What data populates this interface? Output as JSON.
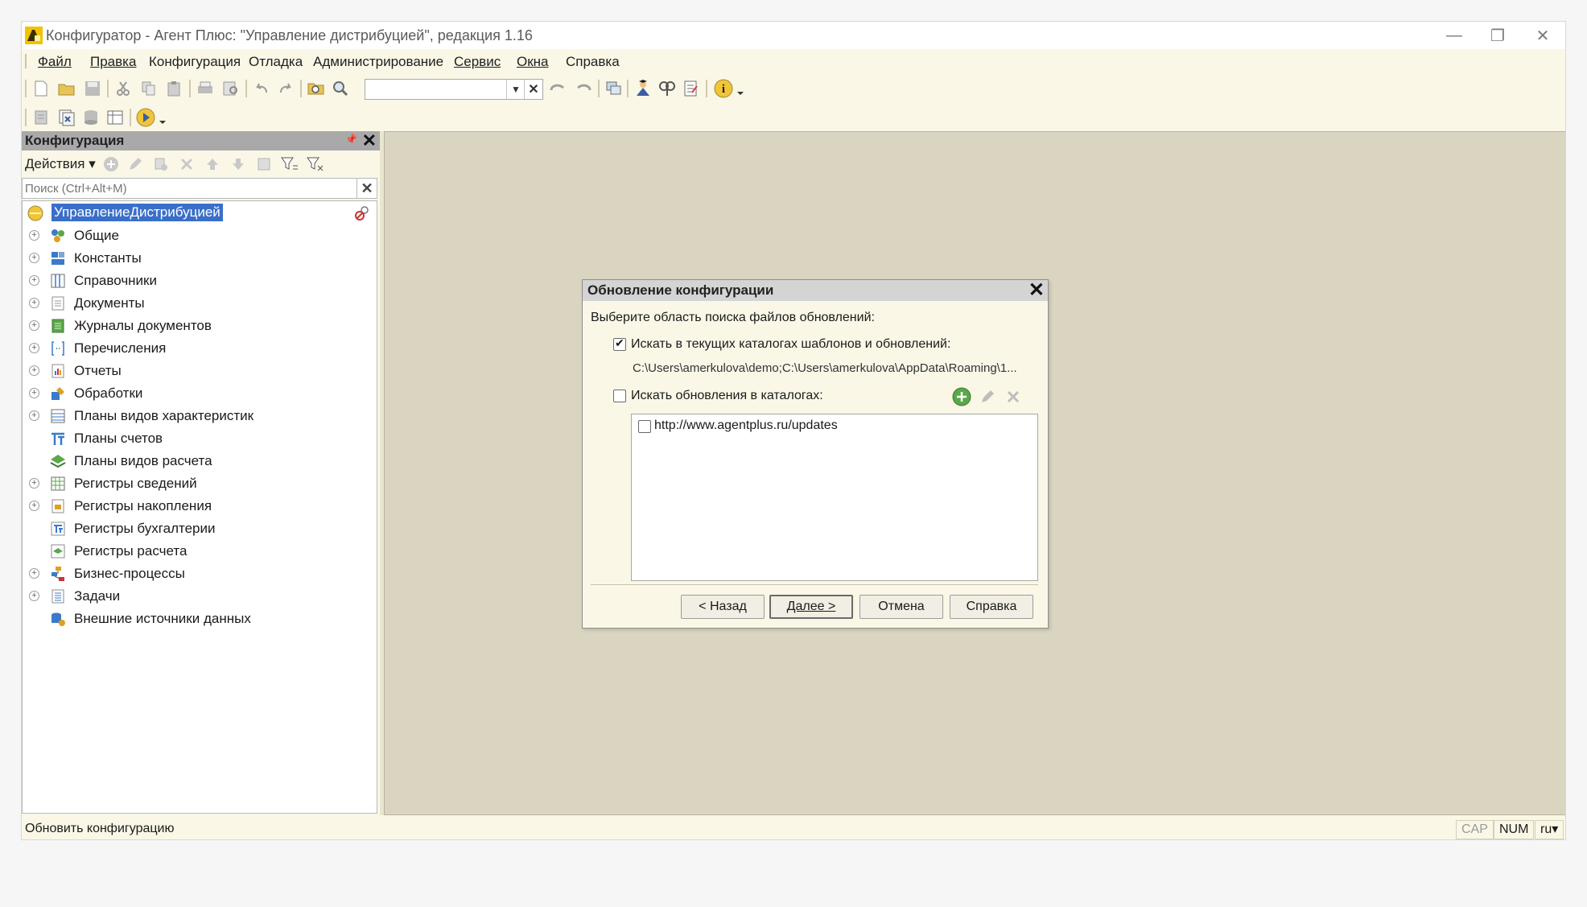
{
  "window": {
    "title": "Конфигуратор - Агент Плюс: \"Управление дистрибуцией\", редакция 1.16"
  },
  "menu": {
    "items": [
      {
        "label": "Файл",
        "underline": true
      },
      {
        "label": "Правка",
        "underline": true
      },
      {
        "label": "Конфигурация",
        "underline": false
      },
      {
        "label": "Отладка",
        "underline": false
      },
      {
        "label": "Администрирование",
        "underline": false
      },
      {
        "label": "Сервис",
        "underline": true
      },
      {
        "label": "Окна",
        "underline": true
      },
      {
        "label": "Справка",
        "underline": false
      }
    ]
  },
  "panel": {
    "title": "Конфигурация",
    "actions_label": "Действия",
    "search_placeholder": "Поиск (Ctrl+Alt+M)",
    "root": "УправлениеДистрибуцией",
    "tree": [
      {
        "label": "Общие",
        "expandable": true,
        "icon": "common-icon"
      },
      {
        "label": "Константы",
        "expandable": true,
        "icon": "constants-icon"
      },
      {
        "label": "Справочники",
        "expandable": true,
        "icon": "catalogs-icon"
      },
      {
        "label": "Документы",
        "expandable": true,
        "icon": "documents-icon"
      },
      {
        "label": "Журналы документов",
        "expandable": true,
        "icon": "journals-icon"
      },
      {
        "label": "Перечисления",
        "expandable": true,
        "icon": "enums-icon"
      },
      {
        "label": "Отчеты",
        "expandable": true,
        "icon": "reports-icon"
      },
      {
        "label": "Обработки",
        "expandable": true,
        "icon": "processing-icon"
      },
      {
        "label": "Планы видов характеристик",
        "expandable": true,
        "icon": "char-plans-icon"
      },
      {
        "label": "Планы счетов",
        "expandable": false,
        "icon": "accounts-icon"
      },
      {
        "label": "Планы видов расчета",
        "expandable": false,
        "icon": "calc-plans-icon"
      },
      {
        "label": "Регистры сведений",
        "expandable": true,
        "icon": "info-registers-icon"
      },
      {
        "label": "Регистры накопления",
        "expandable": true,
        "icon": "accum-registers-icon"
      },
      {
        "label": "Регистры бухгалтерии",
        "expandable": false,
        "icon": "accounting-registers-icon"
      },
      {
        "label": "Регистры расчета",
        "expandable": false,
        "icon": "calc-registers-icon"
      },
      {
        "label": "Бизнес-процессы",
        "expandable": true,
        "icon": "business-processes-icon"
      },
      {
        "label": "Задачи",
        "expandable": true,
        "icon": "tasks-icon"
      },
      {
        "label": "Внешние источники данных",
        "expandable": false,
        "icon": "external-sources-icon"
      }
    ]
  },
  "dialog": {
    "title": "Обновление конфигурации",
    "prompt": "Выберите область поиска файлов обновлений:",
    "option_current": {
      "label": "Искать в текущих каталогах шаблонов и обновлений:",
      "checked": true
    },
    "current_paths": "C:\\Users\\amerkulova\\demo;C:\\Users\\amerkulova\\AppData\\Roaming\\1...",
    "option_catalogs": {
      "label": "Искать обновления в каталогах:",
      "checked": false
    },
    "catalogs": [
      {
        "url": "http://www.agentplus.ru/updates",
        "checked": false
      }
    ],
    "buttons": {
      "back": "< Назад",
      "next": "Далее >",
      "cancel": "Отмена",
      "help": "Справка"
    }
  },
  "status": {
    "text": "Обновить конфигурацию",
    "cap": "CAP",
    "num": "NUM",
    "lang": "ru"
  },
  "colors": {
    "accent_selection": "#3a6fc9",
    "workspace": "#d9d5c0",
    "window_bg": "#faf7e7"
  }
}
